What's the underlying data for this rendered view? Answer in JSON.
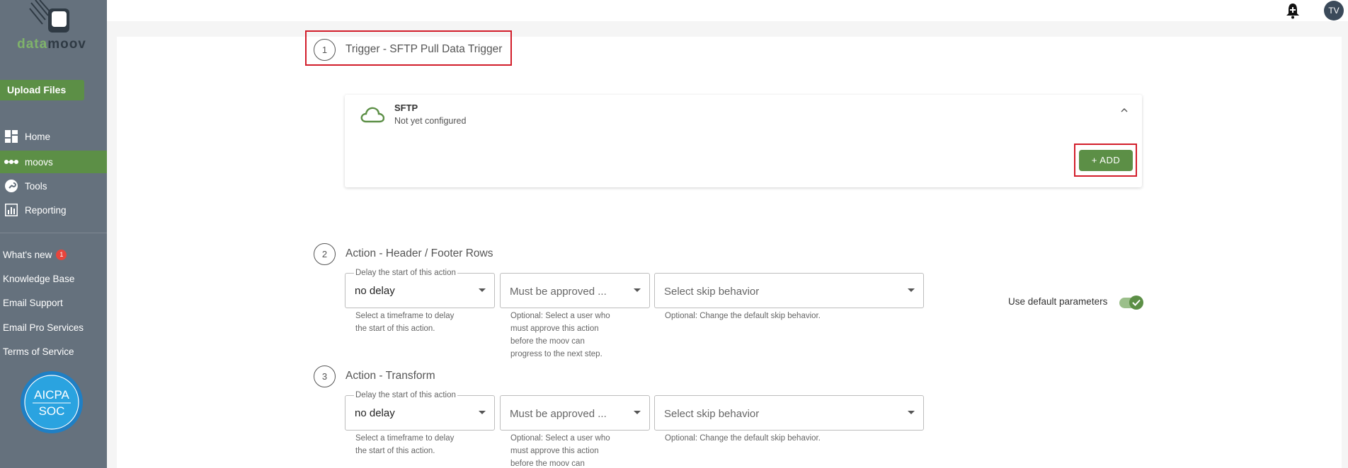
{
  "brand": {
    "logo_prefix": "data",
    "logo_suffix": "moov"
  },
  "sidebar": {
    "upload_label": "Upload Files",
    "nav": [
      {
        "label": "Home",
        "icon": "dashboard-icon",
        "active": false
      },
      {
        "label": "moovs",
        "icon": "dots-chain-icon",
        "active": true
      },
      {
        "label": "Tools",
        "icon": "wrench-icon",
        "active": false
      },
      {
        "label": "Reporting",
        "icon": "bar-chart-icon",
        "active": false
      }
    ],
    "links": [
      {
        "label": "What's new",
        "badge": "1"
      },
      {
        "label": "Knowledge Base"
      },
      {
        "label": "Email Support"
      },
      {
        "label": "Email Pro Services"
      },
      {
        "label": "Terms of Service"
      }
    ],
    "soc": {
      "line1": "AICPA",
      "line2": "SOC"
    }
  },
  "header": {
    "avatar_initials": "TV"
  },
  "steps": [
    {
      "number": "1",
      "title": "Trigger - SFTP Pull Data Trigger"
    },
    {
      "number": "2",
      "title": "Action - Header / Footer Rows"
    },
    {
      "number": "3",
      "title": "Action - Transform"
    }
  ],
  "sftp": {
    "name": "SFTP",
    "status": "Not yet configured",
    "add_label": "+ ADD"
  },
  "action_fields": {
    "delay_legend": "Delay the start of this action",
    "delay_value": "no delay",
    "approval_placeholder": "Must be approved ...",
    "skip_placeholder": "Select skip behavior",
    "delay_help": [
      "Select a timeframe to delay",
      "the start of this action."
    ],
    "approval_help": [
      "Optional: Select a user who",
      "must approve this action",
      "before the moov can",
      "progress to the next step."
    ],
    "approval_help_step3": [
      "Optional: Select a user who",
      "must approve this action",
      "before the moov can"
    ],
    "skip_help": "Optional: Change the default skip behavior."
  },
  "use_default": {
    "label": "Use default parameters",
    "checked": true
  },
  "colors": {
    "sidebar": "#65717d",
    "accent_green": "#5c8f46",
    "highlight_red": "#d21d2a"
  }
}
